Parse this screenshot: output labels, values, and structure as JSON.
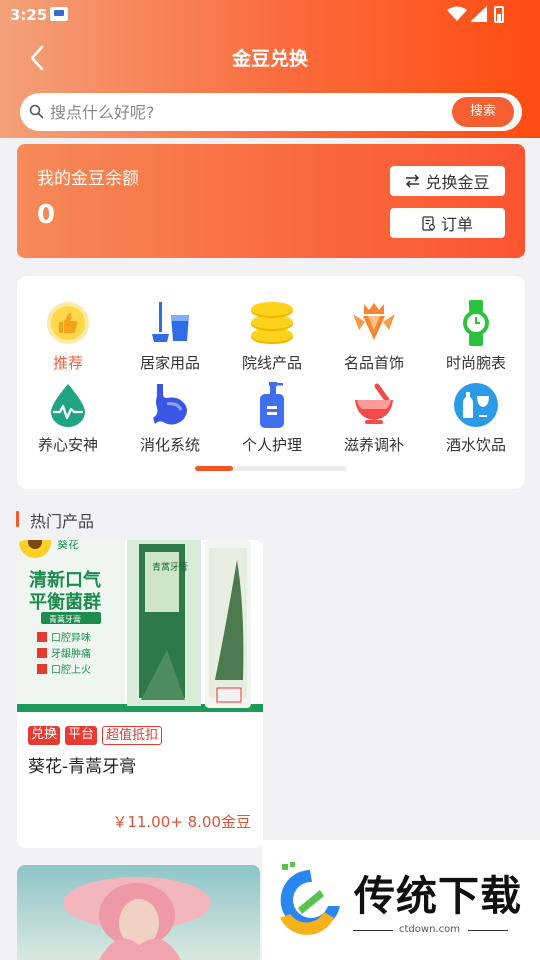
{
  "status_bar": {
    "time": "3:25"
  },
  "header": {
    "title": "金豆兑换"
  },
  "search": {
    "placeholder": "搜点什么好呢?",
    "button_label": "搜索"
  },
  "balance": {
    "label": "我的金豆余额",
    "value": "0",
    "exchange_button": "兑换金豆",
    "order_button": "订单"
  },
  "categories": [
    {
      "label": "推荐",
      "icon": "thumbs-up-icon",
      "active": true
    },
    {
      "label": "居家用品",
      "icon": "mop-bucket-icon"
    },
    {
      "label": "院线产品",
      "icon": "coin-stack-icon"
    },
    {
      "label": "名品首饰",
      "icon": "crown-gem-icon"
    },
    {
      "label": "时尚腕表",
      "icon": "watch-icon"
    },
    {
      "label": "养心安神",
      "icon": "heartbeat-drop-icon"
    },
    {
      "label": "消化系统",
      "icon": "stomach-icon"
    },
    {
      "label": "个人护理",
      "icon": "pump-bottle-icon"
    },
    {
      "label": "滋养调补",
      "icon": "mortar-bowl-icon"
    },
    {
      "label": "酒水饮品",
      "icon": "wine-bottle-icon"
    }
  ],
  "section": {
    "title": "热门产品"
  },
  "products": [
    {
      "image": {
        "brand": "葵花",
        "headline_1": "清新口气",
        "headline_2": "平衡菌群",
        "subtitle": "青蒿牙膏",
        "benefits": [
          "口腔异味",
          "牙龈肿痛",
          "口腔上火"
        ],
        "box_text": "青蒿牙膏"
      },
      "tags": [
        "兑换",
        "平台",
        "超值抵扣"
      ],
      "name": "葵花-青蒿牙膏",
      "price": "￥11.00+ 8.00金豆"
    }
  ],
  "watermark": {
    "text": "传统下载",
    "url": "ctdown.com"
  },
  "colors": {
    "accent": "#f65f32",
    "tag_red": "#e83a30",
    "price": "#e0533a"
  }
}
